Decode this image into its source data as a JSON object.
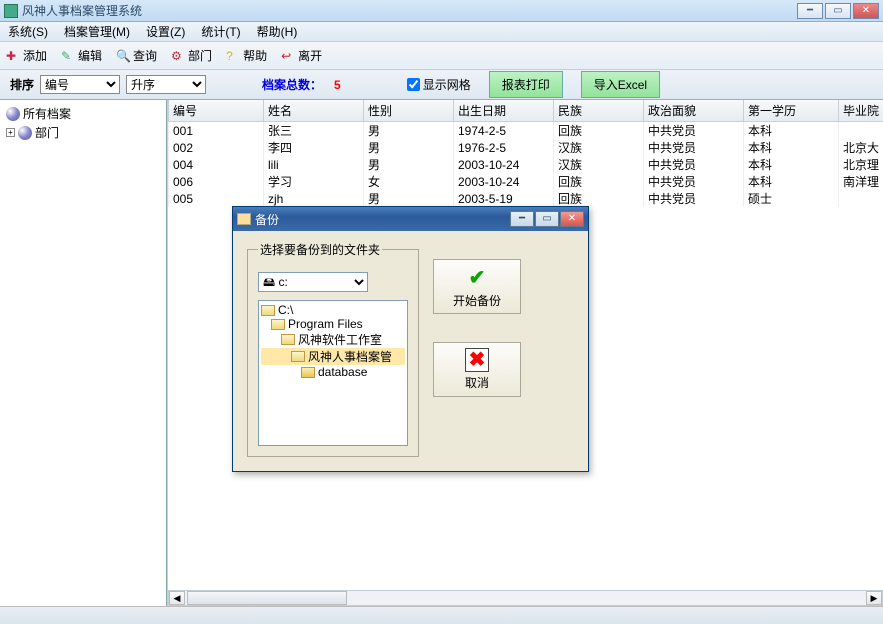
{
  "title": "风神人事档案管理系统",
  "menu": {
    "system": "系统(S)",
    "archive": "档案管理(M)",
    "settings": "设置(Z)",
    "stats": "统计(T)",
    "help": "帮助(H)"
  },
  "toolbar": {
    "add": "添加",
    "edit": "编辑",
    "search": "查询",
    "dept": "部门",
    "help": "帮助",
    "exit": "离开"
  },
  "filter": {
    "sort_label": "排序",
    "field": "编号",
    "order": "升序",
    "total_label": "档案总数：",
    "count": "5",
    "show_grid": "显示网格",
    "print": "报表打印",
    "excel": "导入Excel"
  },
  "tree": {
    "all": "所有档案",
    "dept": "部门"
  },
  "columns": [
    "编号",
    "姓名",
    "性别",
    "出生日期",
    "民族",
    "政治面貌",
    "第一学历",
    "毕业院"
  ],
  "rows": [
    {
      "id": "001",
      "name": "张三",
      "sex": "男",
      "birth": "1974-2-5",
      "ethnic": "回族",
      "pol": "中共党员",
      "edu": "本科",
      "school": ""
    },
    {
      "id": "002",
      "name": "李四",
      "sex": "男",
      "birth": "1976-2-5",
      "ethnic": "汉族",
      "pol": "中共党员",
      "edu": "本科",
      "school": "北京大"
    },
    {
      "id": "004",
      "name": "lili",
      "sex": "男",
      "birth": "2003-10-24",
      "ethnic": "汉族",
      "pol": "中共党员",
      "edu": "本科",
      "school": "北京理"
    },
    {
      "id": "006",
      "name": "学习",
      "sex": "女",
      "birth": "2003-10-24",
      "ethnic": "回族",
      "pol": "中共党员",
      "edu": "本科",
      "school": "南洋理"
    },
    {
      "id": "005",
      "name": "zjh",
      "sex": "男",
      "birth": "2003-5-19",
      "ethnic": "回族",
      "pol": "中共党员",
      "edu": "硕士",
      "school": ""
    }
  ],
  "dialog": {
    "title": "备份",
    "group_label": "选择要备份到的文件夹",
    "drive": "c:",
    "folders": [
      "C:\\",
      "Program Files",
      "风神软件工作室",
      "风神人事档案管",
      "database"
    ],
    "selected_index": 3,
    "start": "开始备份",
    "cancel": "取消"
  }
}
